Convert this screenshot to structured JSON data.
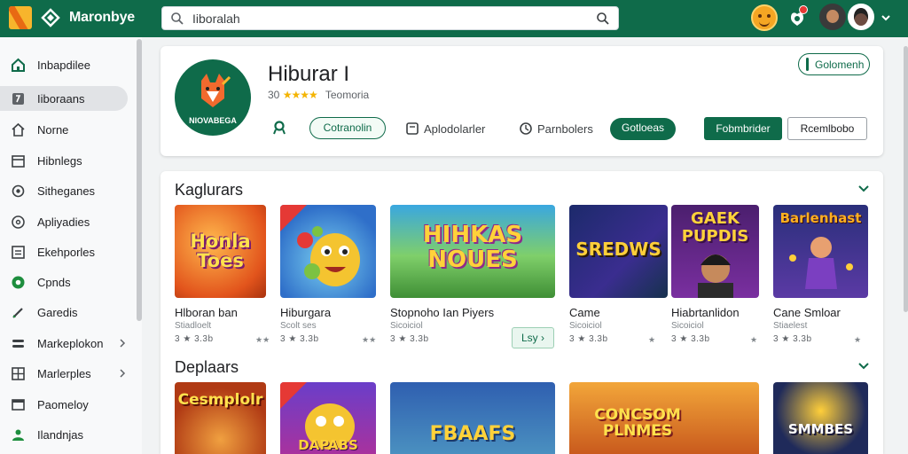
{
  "topbar": {
    "brand": "Maronbye",
    "search_value": "Iiboralah",
    "colors": {
      "bar": "#0f6b4a",
      "accent": "#f7b52c"
    },
    "icons": [
      "logo-icon",
      "brand-icon",
      "search-icon",
      "search-submit-icon",
      "emoji-avatar-icon",
      "apps-icon",
      "notification-dot-icon",
      "user-avatar-icon",
      "profile-avatar-icon",
      "chevron-down-icon"
    ]
  },
  "sidebar": {
    "items": [
      {
        "label": "Inbapdilee",
        "icon": "home-icon"
      },
      {
        "label": "Iiboraans",
        "icon": "book-icon",
        "active": true
      },
      {
        "label": "Norne",
        "icon": "house-icon"
      },
      {
        "label": "Hibnlegs",
        "icon": "calendar-icon"
      },
      {
        "label": "Sitheganes",
        "icon": "gear-icon"
      },
      {
        "label": "Apliyadies",
        "icon": "help-icon"
      },
      {
        "label": "Ekehporles",
        "icon": "list-icon"
      },
      {
        "label": "Cpnds",
        "icon": "green-circle-icon"
      },
      {
        "label": "Garedis",
        "icon": "tag-icon"
      },
      {
        "label": "Markeplokon",
        "icon": "layers-icon",
        "has_submenu": true
      },
      {
        "label": "Marlerples",
        "icon": "grid-icon",
        "has_submenu": true
      },
      {
        "label": "Paomeloy",
        "icon": "window-icon"
      },
      {
        "label": "Ilandnjas",
        "icon": "user-icon"
      }
    ]
  },
  "app": {
    "logo_text": "NIOVABEGA",
    "title": "Hiburar I",
    "rating_prefix": "30",
    "stars": "★★★★",
    "meta_text": "Teomoria",
    "top_pill": "Golomenh",
    "follow_button": "Cotranolin",
    "link1": "Aplodolarler",
    "link2": "Parnbolers",
    "green_button": "Gotloeas",
    "primary_button": "Fobmbrider",
    "secondary_button": "Rcemlbobo"
  },
  "sections": [
    {
      "title": "Kaglurars",
      "tiles": [
        {
          "art_text": "Honla Toes",
          "name": "Hlboran ban",
          "sub": "Stiadloelt",
          "rating": "3 ★ 3.3b",
          "dl": "★★"
        },
        {
          "art_text": "",
          "name": "Hiburgara",
          "sub": "Scolt ses",
          "rating": "3 ★ 3.3b",
          "dl": "★★"
        },
        {
          "art_text": "HIHKAS NOUES",
          "name": "Stopnoho Ian Piyers",
          "sub": "Sicoiciol",
          "rating": "3 ★ 3.3b",
          "install": "Lsy ›"
        },
        {
          "art_text": "SREDWS",
          "name": "Came",
          "sub": "Sicoiciol",
          "rating": "3 ★ 3.3b",
          "dl": "★"
        },
        {
          "art_text": "GAEK PUPDIS",
          "name": "Hiabrtanlidon",
          "sub": "Sicoiciol",
          "rating": "3 ★ 3.3b",
          "dl": "★"
        },
        {
          "art_text": "Barlenhast",
          "name": "Cane Smloar",
          "sub": "Stiaelest",
          "rating": "3 ★ 3.3b",
          "dl": "★"
        }
      ]
    },
    {
      "title": "Deplaars",
      "tiles": [
        {
          "art_text": "Cesmplolr"
        },
        {
          "art_text": "DAPABS"
        },
        {
          "art_text": "FBAAFS"
        },
        {
          "art_text": "CONCSOM PLNMES"
        },
        {
          "art_text": ""
        },
        {
          "art_text": "SMMBES"
        }
      ]
    }
  ]
}
